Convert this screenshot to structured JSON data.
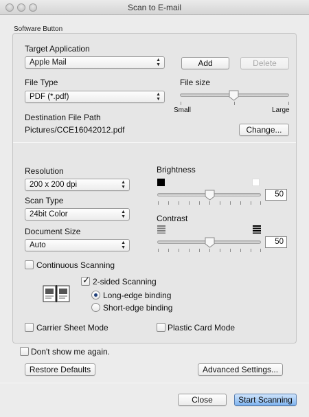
{
  "window": {
    "title": "Scan to E-mail"
  },
  "group": {
    "label": "Software Button"
  },
  "target_app": {
    "label": "Target Application",
    "selected": "Apple Mail",
    "add_label": "Add",
    "delete_label": "Delete"
  },
  "file_type": {
    "label": "File Type",
    "selected": "PDF (*.pdf)"
  },
  "file_size": {
    "label": "File size",
    "min_label": "Small",
    "max_label": "Large",
    "level": 0.5
  },
  "destination": {
    "label": "Destination File Path",
    "path": "Pictures/CCE16042012.pdf",
    "change_label": "Change..."
  },
  "resolution": {
    "label": "Resolution",
    "selected": "200 x 200 dpi"
  },
  "scan_type": {
    "label": "Scan Type",
    "selected": "24bit Color"
  },
  "document_size": {
    "label": "Document Size",
    "selected": "Auto"
  },
  "brightness": {
    "label": "Brightness",
    "value": "50"
  },
  "contrast": {
    "label": "Contrast",
    "value": "50"
  },
  "continuous": {
    "label": "Continuous Scanning",
    "checked": false
  },
  "duplex": {
    "label": "2-sided Scanning",
    "checked": true,
    "long_edge": "Long-edge binding",
    "short_edge": "Short-edge binding",
    "selected": "long"
  },
  "carrier": {
    "label": "Carrier Sheet Mode",
    "checked": false
  },
  "plastic": {
    "label": "Plastic Card Mode",
    "checked": false
  },
  "dont_show": {
    "label": "Don't show me again.",
    "checked": false
  },
  "buttons": {
    "restore": "Restore Defaults",
    "advanced": "Advanced Settings...",
    "close": "Close",
    "start": "Start Scanning"
  },
  "colors": {
    "primary_button": "#7fb3ef",
    "window_bg": "#ececec"
  }
}
